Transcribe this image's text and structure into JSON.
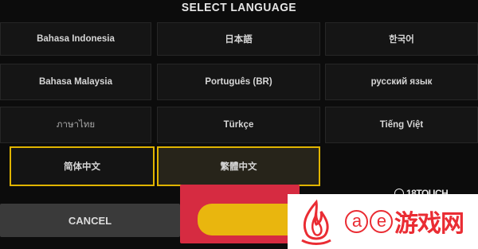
{
  "dialog": {
    "title": "SELECT LANGUAGE"
  },
  "languages": [
    {
      "label": "Bahasa Indonesia"
    },
    {
      "label": "日本語"
    },
    {
      "label": "한국어"
    },
    {
      "label": "Bahasa Malaysia"
    },
    {
      "label": "Português (BR)"
    },
    {
      "label": "русский язык"
    },
    {
      "label": "ภาษาไทย"
    },
    {
      "label": "Türkçe"
    },
    {
      "label": "Tiếng Việt"
    },
    {
      "label": "简体中文"
    },
    {
      "label": "繁體中文"
    }
  ],
  "actions": {
    "cancel_label": "CANCEL",
    "confirm_label": ""
  },
  "watermarks": {
    "small": "18TOUCH",
    "site_circle_1": "a",
    "site_circle_2": "e",
    "site_name": "游戏网"
  },
  "colors": {
    "accent_yellow": "#e9b60e",
    "highlight_red": "#d62b41",
    "watermark_red": "#ea2c33"
  }
}
